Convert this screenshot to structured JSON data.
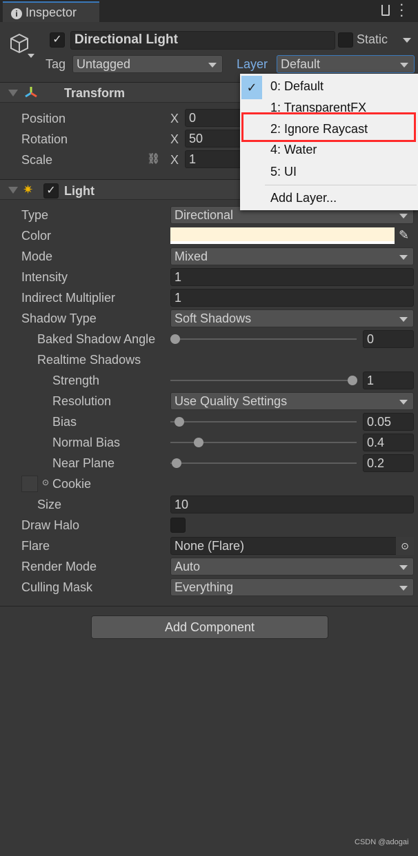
{
  "window": {
    "tab_title": "Inspector"
  },
  "object": {
    "active": true,
    "name": "Directional Light",
    "static_label": "Static",
    "static": false,
    "tag_label": "Tag",
    "tag_value": "Untagged",
    "layer_label": "Layer",
    "layer_value": "Default"
  },
  "transform": {
    "title": "Transform",
    "rows": [
      {
        "label": "Position",
        "axis": "X",
        "value": "0"
      },
      {
        "label": "Rotation",
        "axis": "X",
        "value": "50"
      },
      {
        "label": "Scale",
        "axis": "X",
        "value": "1"
      }
    ]
  },
  "light": {
    "title": "Light",
    "enabled": true,
    "type_label": "Type",
    "type_value": "Directional",
    "color_label": "Color",
    "color": "#fff3d9",
    "mode_label": "Mode",
    "mode_value": "Mixed",
    "intensity_label": "Intensity",
    "intensity_value": "1",
    "indirect_label": "Indirect Multiplier",
    "indirect_value": "1",
    "shadow_type_label": "Shadow Type",
    "shadow_type_value": "Soft Shadows",
    "baked_angle_label": "Baked Shadow Angle",
    "baked_angle_value": "0",
    "realtime_label": "Realtime Shadows",
    "strength_label": "Strength",
    "strength_value": "1",
    "resolution_label": "Resolution",
    "resolution_value": "Use Quality Settings",
    "bias_label": "Bias",
    "bias_value": "0.05",
    "normal_bias_label": "Normal Bias",
    "normal_bias_value": "0.4",
    "near_plane_label": "Near Plane",
    "near_plane_value": "0.2",
    "cookie_label": "Cookie",
    "size_label": "Size",
    "size_value": "10",
    "draw_halo_label": "Draw Halo",
    "flare_label": "Flare",
    "flare_value": "None (Flare)",
    "render_mode_label": "Render Mode",
    "render_mode_value": "Auto",
    "culling_label": "Culling Mask",
    "culling_value": "Everything"
  },
  "add_component": "Add Component",
  "layer_menu": {
    "items": [
      "0: Default",
      "1: TransparentFX",
      "2: Ignore Raycast",
      "4: Water",
      "5: UI"
    ],
    "selected": "0: Default",
    "highlighted": "2: Ignore Raycast",
    "add_layer": "Add Layer..."
  },
  "watermark": "CSDN @adogai",
  "colors": {
    "accent": "#3a79bb",
    "highlight_box": "#ff2a2a",
    "check_bg": "#99c9ef"
  }
}
